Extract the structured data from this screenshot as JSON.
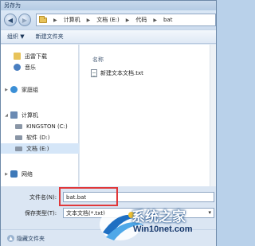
{
  "window": {
    "title": "另存为"
  },
  "address": {
    "crumbs": [
      "计算机",
      "文档 (E:)",
      "代码",
      "bat"
    ]
  },
  "toolbar": {
    "organize": "组织 ▼",
    "new_folder": "新建文件夹"
  },
  "nav": {
    "items": [
      {
        "label": "迅雷下载",
        "icon": "download-folder-icon"
      },
      {
        "label": "音乐",
        "icon": "music-icon"
      },
      {
        "label": "家庭组",
        "icon": "homegroup-icon"
      },
      {
        "label": "计算机",
        "icon": "computer-icon"
      },
      {
        "label": "KINGSTON (C:)",
        "icon": "drive-icon"
      },
      {
        "label": "软件 (D:)",
        "icon": "drive-icon"
      },
      {
        "label": "文档 (E:)",
        "icon": "drive-icon"
      },
      {
        "label": "网络",
        "icon": "network-icon"
      }
    ]
  },
  "main": {
    "column_header": "名称",
    "files": [
      {
        "name": "新建文本文档.txt",
        "icon": "text-file-icon"
      }
    ]
  },
  "form": {
    "filename_label": "文件名(N):",
    "filename_value": "bat.bat",
    "filetype_label": "保存类型(T):",
    "filetype_value": "文本文档(*.txt)"
  },
  "footer": {
    "hide_folders": "隐藏文件夹"
  },
  "watermark": {
    "line1": "系统之家",
    "line2": "Win10net.com"
  },
  "colors": {
    "highlight": "#e0383a",
    "selected": "#d5e6f8"
  }
}
